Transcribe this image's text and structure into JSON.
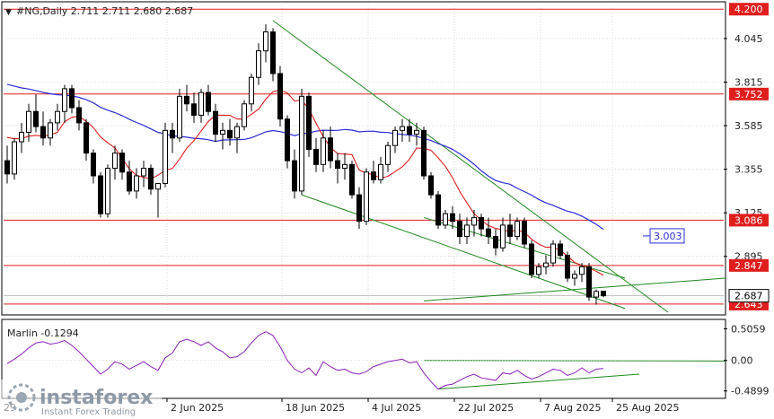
{
  "header": {
    "symbol_line": "#NG,Daily  2.711 2.711 2.680 2.687",
    "indicator_label": "Marlin -0.1294"
  },
  "watermark": {
    "brand": "instaforex",
    "tagline": "Instant Forex Trading"
  },
  "colors": {
    "bull": "#000000",
    "bear": "#000000",
    "ma_blue": "#2c2cd6",
    "ma_red": "#e01e1e",
    "channel": "#1e8a1e",
    "level": "#e01e1e",
    "osc": "#8b1fb8",
    "grid": "#c8c8c8"
  },
  "chart_data": [
    {
      "type": "candlestick",
      "y_axis_ticks": [
        "4.045",
        "3.815",
        "3.585",
        "3.355",
        "3.125",
        "2.895"
      ],
      "ylim": [
        2.6,
        4.22
      ],
      "x_tick_labels": [
        "2 Jun 2025",
        "18 Jun 2025",
        "4 Jul 2025",
        "22 Jul 2025",
        "7 Aug 2025",
        "25 Aug 2025"
      ],
      "x_first_label_partial": "29",
      "horizontal_levels": [
        {
          "value": 4.2,
          "label": "4.200"
        },
        {
          "value": 3.752,
          "label": "3.752"
        },
        {
          "value": 3.086,
          "label": "3.086"
        },
        {
          "value": 2.847,
          "label": "2.847"
        },
        {
          "value": 2.643,
          "label": "2.643"
        }
      ],
      "current_price": {
        "value": 2.687,
        "label": "2.687"
      },
      "blue_ma_label": {
        "value": 3.003,
        "label": "3.003"
      },
      "ohlc": [
        [
          3.4,
          3.48,
          3.28,
          3.33
        ],
        [
          3.33,
          3.52,
          3.3,
          3.5
        ],
        [
          3.5,
          3.6,
          3.44,
          3.55
        ],
        [
          3.55,
          3.7,
          3.5,
          3.66
        ],
        [
          3.66,
          3.75,
          3.55,
          3.58
        ],
        [
          3.58,
          3.66,
          3.48,
          3.52
        ],
        [
          3.52,
          3.62,
          3.48,
          3.6
        ],
        [
          3.6,
          3.7,
          3.56,
          3.66
        ],
        [
          3.66,
          3.8,
          3.6,
          3.78
        ],
        [
          3.78,
          3.8,
          3.65,
          3.68
        ],
        [
          3.68,
          3.72,
          3.56,
          3.6
        ],
        [
          3.6,
          3.62,
          3.4,
          3.44
        ],
        [
          3.44,
          3.46,
          3.28,
          3.32
        ],
        [
          3.32,
          3.34,
          3.1,
          3.12
        ],
        [
          3.12,
          3.38,
          3.1,
          3.36
        ],
        [
          3.36,
          3.48,
          3.3,
          3.44
        ],
        [
          3.44,
          3.46,
          3.3,
          3.34
        ],
        [
          3.34,
          3.4,
          3.22,
          3.24
        ],
        [
          3.24,
          3.36,
          3.2,
          3.32
        ],
        [
          3.32,
          3.4,
          3.26,
          3.36
        ],
        [
          3.36,
          3.38,
          3.22,
          3.25
        ],
        [
          3.25,
          3.28,
          3.1,
          3.28
        ],
        [
          3.28,
          3.6,
          3.26,
          3.56
        ],
        [
          3.56,
          3.6,
          3.44,
          3.52
        ],
        [
          3.52,
          3.78,
          3.5,
          3.74
        ],
        [
          3.74,
          3.8,
          3.66,
          3.7
        ],
        [
          3.7,
          3.76,
          3.6,
          3.64
        ],
        [
          3.64,
          3.78,
          3.6,
          3.76
        ],
        [
          3.76,
          3.8,
          3.64,
          3.66
        ],
        [
          3.66,
          3.7,
          3.5,
          3.54
        ],
        [
          3.54,
          3.6,
          3.46,
          3.56
        ],
        [
          3.56,
          3.62,
          3.48,
          3.52
        ],
        [
          3.52,
          3.6,
          3.44,
          3.58
        ],
        [
          3.58,
          3.72,
          3.56,
          3.7
        ],
        [
          3.7,
          3.86,
          3.66,
          3.84
        ],
        [
          3.84,
          4.02,
          3.8,
          3.98
        ],
        [
          3.98,
          4.12,
          3.92,
          4.08
        ],
        [
          4.08,
          4.1,
          3.82,
          3.86
        ],
        [
          3.86,
          3.9,
          3.58,
          3.62
        ],
        [
          3.62,
          3.64,
          3.36,
          3.4
        ],
        [
          3.4,
          3.46,
          3.2,
          3.24
        ],
        [
          3.24,
          3.78,
          3.22,
          3.74
        ],
        [
          3.74,
          3.76,
          3.42,
          3.46
        ],
        [
          3.46,
          3.52,
          3.34,
          3.38
        ],
        [
          3.38,
          3.56,
          3.34,
          3.52
        ],
        [
          3.52,
          3.58,
          3.36,
          3.4
        ],
        [
          3.4,
          3.44,
          3.28,
          3.36
        ],
        [
          3.36,
          3.44,
          3.3,
          3.38
        ],
        [
          3.38,
          3.4,
          3.2,
          3.22
        ],
        [
          3.22,
          3.26,
          3.04,
          3.08
        ],
        [
          3.08,
          3.36,
          3.06,
          3.34
        ],
        [
          3.34,
          3.4,
          3.28,
          3.3
        ],
        [
          3.3,
          3.42,
          3.28,
          3.38
        ],
        [
          3.38,
          3.5,
          3.34,
          3.48
        ],
        [
          3.48,
          3.58,
          3.44,
          3.56
        ],
        [
          3.56,
          3.62,
          3.5,
          3.58
        ],
        [
          3.58,
          3.62,
          3.5,
          3.54
        ],
        [
          3.54,
          3.6,
          3.48,
          3.56
        ],
        [
          3.56,
          3.58,
          3.3,
          3.32
        ],
        [
          3.32,
          3.34,
          3.2,
          3.22
        ],
        [
          3.22,
          3.24,
          3.04,
          3.06
        ],
        [
          3.06,
          3.14,
          3.04,
          3.12
        ],
        [
          3.12,
          3.16,
          3.04,
          3.08
        ],
        [
          3.08,
          3.12,
          2.96,
          3.0
        ],
        [
          3.0,
          3.1,
          2.96,
          3.06
        ],
        [
          3.06,
          3.14,
          3.0,
          3.1
        ],
        [
          3.1,
          3.12,
          3.0,
          3.04
        ],
        [
          3.04,
          3.1,
          2.96,
          3.0
        ],
        [
          3.0,
          3.04,
          2.9,
          2.94
        ],
        [
          2.94,
          3.1,
          2.92,
          3.06
        ],
        [
          3.06,
          3.12,
          2.96,
          3.0
        ],
        [
          3.0,
          3.1,
          2.98,
          3.08
        ],
        [
          3.08,
          3.1,
          2.94,
          2.96
        ],
        [
          2.96,
          2.98,
          2.78,
          2.8
        ],
        [
          2.8,
          2.86,
          2.78,
          2.84
        ],
        [
          2.84,
          2.9,
          2.8,
          2.86
        ],
        [
          2.86,
          2.98,
          2.84,
          2.96
        ],
        [
          2.96,
          2.98,
          2.88,
          2.9
        ],
        [
          2.9,
          2.92,
          2.76,
          2.78
        ],
        [
          2.78,
          2.82,
          2.74,
          2.8
        ],
        [
          2.8,
          2.86,
          2.76,
          2.84
        ],
        [
          2.84,
          2.86,
          2.66,
          2.68
        ],
        [
          2.68,
          2.72,
          2.64,
          2.71
        ],
        [
          2.711,
          2.711,
          2.68,
          2.687
        ]
      ]
    },
    {
      "type": "line",
      "name": "Marlin",
      "y_axis_ticks": [
        "0.5059",
        "0.00",
        "-0.4899"
      ],
      "ylim": [
        -0.58,
        0.6
      ],
      "last_value": -0.1294,
      "values": [
        -0.05,
        0.02,
        0.1,
        0.2,
        0.28,
        0.3,
        0.26,
        0.28,
        0.32,
        0.24,
        0.14,
        0.02,
        -0.1,
        -0.22,
        -0.14,
        -0.02,
        -0.06,
        -0.14,
        -0.08,
        -0.02,
        -0.1,
        -0.16,
        0.04,
        0.12,
        0.3,
        0.34,
        0.3,
        0.24,
        0.3,
        0.2,
        0.14,
        0.04,
        0.06,
        0.14,
        0.28,
        0.4,
        0.46,
        0.4,
        0.22,
        0.0,
        -0.14,
        -0.2,
        -0.12,
        -0.24,
        -0.02,
        -0.1,
        -0.16,
        -0.14,
        -0.2,
        -0.22,
        -0.18,
        -0.1,
        -0.06,
        -0.02,
        0.0,
        0.02,
        -0.04,
        -0.02,
        -0.2,
        -0.34,
        -0.46,
        -0.4,
        -0.38,
        -0.32,
        -0.26,
        -0.22,
        -0.28,
        -0.3,
        -0.32,
        -0.2,
        -0.22,
        -0.16,
        -0.24,
        -0.3,
        -0.26,
        -0.2,
        -0.14,
        -0.16,
        -0.24,
        -0.2,
        -0.12,
        -0.2,
        -0.14,
        -0.1294
      ]
    }
  ]
}
